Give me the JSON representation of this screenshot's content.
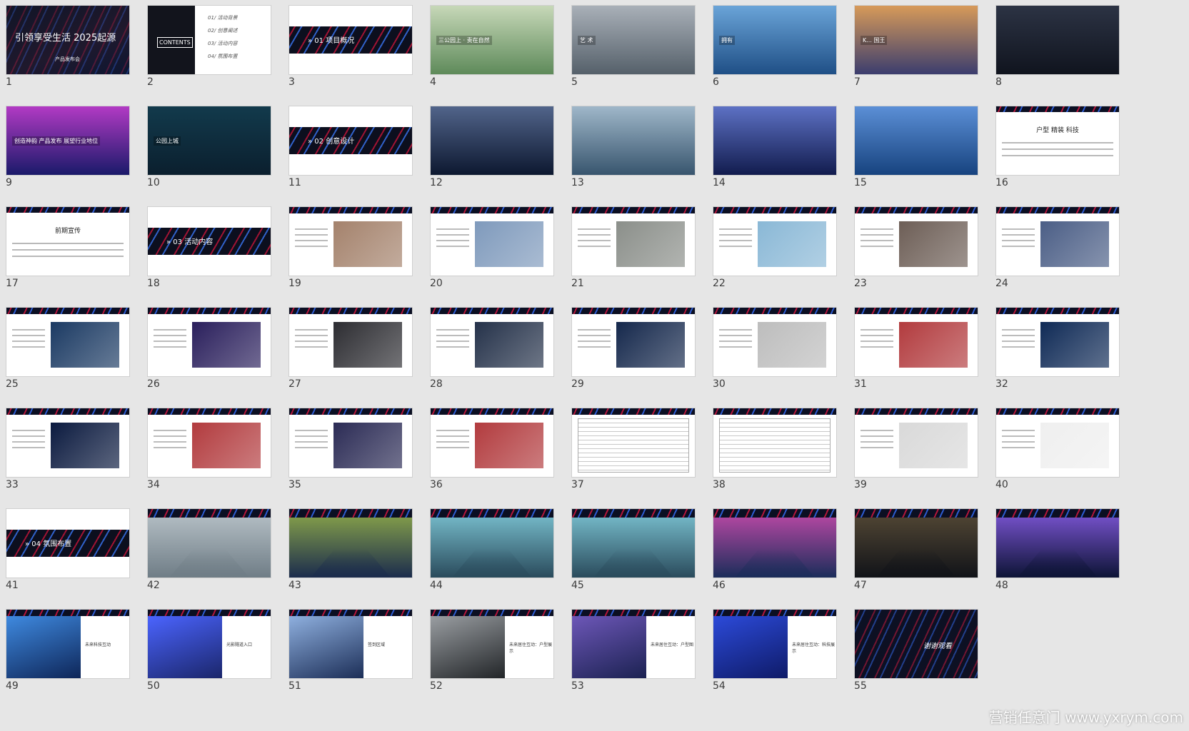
{
  "slides": [
    {
      "n": "1",
      "style": "cover",
      "title": "引领享受生活 2025起源",
      "subtitle": "产品发布会"
    },
    {
      "n": "2",
      "style": "contents",
      "title": "CONTENTS",
      "items": [
        "01/ 活动背景",
        "02/ 创意阐述",
        "03/ 活动内容",
        "04/ 氛围布置"
      ]
    },
    {
      "n": "3",
      "style": "section",
      "title": "01  项目概况"
    },
    {
      "n": "4",
      "style": "photo",
      "bg": "#5e8a5a",
      "bg2": "#c7d8b8",
      "label": "三公园上 · 责在自然"
    },
    {
      "n": "5",
      "style": "photo",
      "bg": "#55606a",
      "bg2": "#a9b0b8",
      "label": "艺 术"
    },
    {
      "n": "6",
      "style": "photo",
      "bg": "#1f4f86",
      "bg2": "#6aa4d8",
      "label": "拥有"
    },
    {
      "n": "7",
      "style": "photo",
      "bg": "#3b3d6e",
      "bg2": "#d79a59",
      "label": "K... 国王"
    },
    {
      "n": "8",
      "style": "dark",
      "bg": "#10141e",
      "bg2": "#2c3344",
      "label": ""
    },
    {
      "n": "9",
      "style": "dark",
      "bg": "#1a1a6a",
      "bg2": "#b23ac4",
      "label": "创造神韵  产品发布  展望行业地位"
    },
    {
      "n": "10",
      "style": "dark",
      "bg": "#0b1f2e",
      "bg2": "#123a4c",
      "label": "公园上城"
    },
    {
      "n": "11",
      "style": "section",
      "title": "02  创意设计"
    },
    {
      "n": "12",
      "style": "dark",
      "bg": "#0d1830",
      "bg2": "#51648a",
      "label": ""
    },
    {
      "n": "13",
      "style": "photo",
      "bg": "#38556e",
      "bg2": "#9fb7c9",
      "label": ""
    },
    {
      "n": "14",
      "style": "dark",
      "bg": "#121c4e",
      "bg2": "#5d71c4",
      "label": ""
    },
    {
      "n": "15",
      "style": "photo",
      "bg": "#17437f",
      "bg2": "#5b8fd6",
      "label": ""
    },
    {
      "n": "16",
      "style": "white",
      "label": "户型  精装  科技"
    },
    {
      "n": "17",
      "style": "white",
      "label": "前期宣传"
    },
    {
      "n": "18",
      "style": "section",
      "title": "03  活动内容"
    },
    {
      "n": "19",
      "style": "content",
      "img": "#a4826c"
    },
    {
      "n": "20",
      "style": "content",
      "img": "#7f9abc"
    },
    {
      "n": "21",
      "style": "content",
      "img": "#8b8f8a"
    },
    {
      "n": "22",
      "style": "content",
      "img": "#8ab8d6"
    },
    {
      "n": "23",
      "style": "content",
      "img": "#6d5e56"
    },
    {
      "n": "24",
      "style": "content",
      "img": "#4b5e86"
    },
    {
      "n": "25",
      "style": "content",
      "img": "#1b3a63"
    },
    {
      "n": "26",
      "style": "content",
      "img": "#2a1f5c"
    },
    {
      "n": "27",
      "style": "content",
      "img": "#2d2d32"
    },
    {
      "n": "28",
      "style": "content",
      "img": "#25324a"
    },
    {
      "n": "29",
      "style": "content",
      "img": "#15284c"
    },
    {
      "n": "30",
      "style": "content",
      "img": "#bdbdbd"
    },
    {
      "n": "31",
      "style": "content",
      "img": "#b23b3e"
    },
    {
      "n": "32",
      "style": "content",
      "img": "#0f2a56"
    },
    {
      "n": "33",
      "style": "content",
      "img": "#0b1a3f"
    },
    {
      "n": "34",
      "style": "content",
      "img": "#b23b3e"
    },
    {
      "n": "35",
      "style": "content",
      "img": "#2b2b55"
    },
    {
      "n": "36",
      "style": "content",
      "img": "#b23b3e"
    },
    {
      "n": "37",
      "style": "table"
    },
    {
      "n": "38",
      "style": "table"
    },
    {
      "n": "39",
      "style": "content",
      "img": "#d9d9d9"
    },
    {
      "n": "40",
      "style": "content",
      "img": "#efefef"
    },
    {
      "n": "41",
      "style": "section",
      "title": "04  氛围布置"
    },
    {
      "n": "42",
      "style": "render",
      "bg": "#6f7d86",
      "bg2": "#b9c3c9"
    },
    {
      "n": "43",
      "style": "render",
      "bg": "#1b2c4c",
      "bg2": "#8da84a"
    },
    {
      "n": "44",
      "style": "render",
      "bg": "#2a4b5c",
      "bg2": "#7cc4d3"
    },
    {
      "n": "45",
      "style": "render",
      "bg": "#2a4b5c",
      "bg2": "#7cc4d3"
    },
    {
      "n": "46",
      "style": "render",
      "bg": "#1b2d5a",
      "bg2": "#c24aa9"
    },
    {
      "n": "47",
      "style": "render",
      "bg": "#111318",
      "bg2": "#564a36"
    },
    {
      "n": "48",
      "style": "render",
      "bg": "#0d1436",
      "bg2": "#7f57d8"
    },
    {
      "n": "49",
      "style": "half",
      "img": "#0d2456",
      "bg2": "#3f8ae0",
      "label": "未来科技互动"
    },
    {
      "n": "50",
      "style": "half",
      "img": "#1a2568",
      "bg2": "#4b64ff",
      "label": "光影隧道入口"
    },
    {
      "n": "51",
      "style": "half",
      "img": "#1a2c55",
      "bg2": "#8fb0df",
      "label": "签到区域"
    },
    {
      "n": "52",
      "style": "half",
      "img": "#202326",
      "bg2": "#9a9ea2",
      "label": "未来居住互动：户型展示"
    },
    {
      "n": "53",
      "style": "half",
      "img": "#1a2150",
      "bg2": "#6d57b8",
      "label": "未来居住互动：户型图"
    },
    {
      "n": "54",
      "style": "half",
      "img": "#0e1a66",
      "bg2": "#2c4ad9",
      "label": "未来居住互动：科技展示"
    },
    {
      "n": "55",
      "style": "end",
      "label": "谢谢观看"
    }
  ],
  "watermark": "营销任意门 www.yxrym.com"
}
